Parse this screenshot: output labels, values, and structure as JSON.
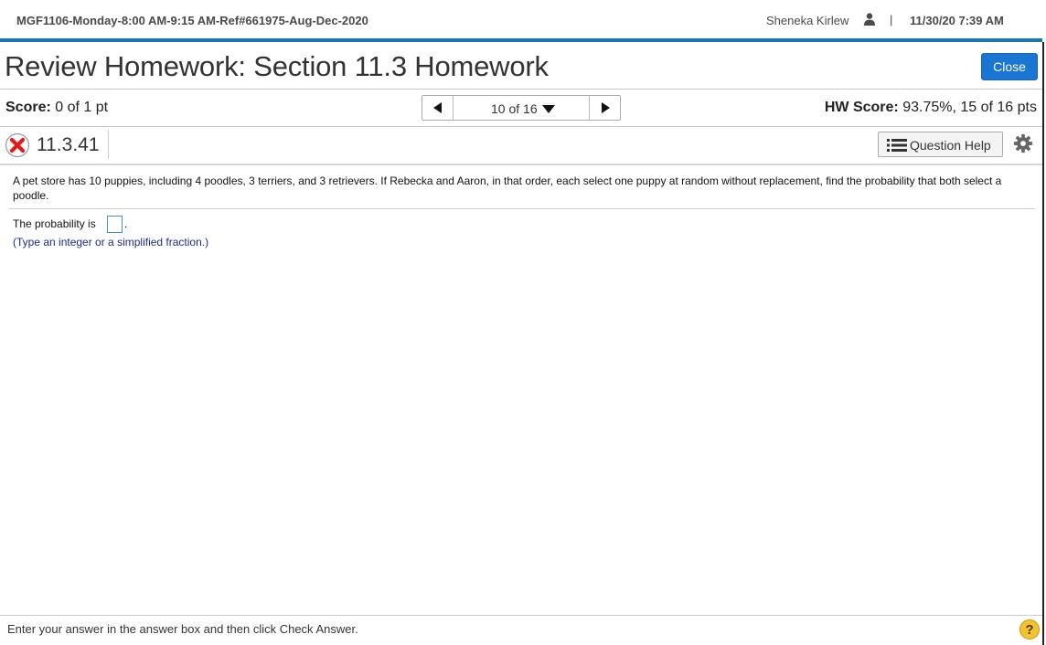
{
  "header": {
    "course": "MGF1106-Monday-8:00 AM-9:15 AM-Ref#661975-Aug-Dec-2020",
    "user_name": "Sheneka Kirlew",
    "separator": "|",
    "datetime": "11/30/20 7:39 AM",
    "user_icon": "user-icon"
  },
  "page": {
    "title": "Review Homework: Section 11.3 Homework",
    "close_label": "Close"
  },
  "score": {
    "label": "Score:",
    "value": "0 of 1 pt"
  },
  "pager": {
    "label": "10 of 16"
  },
  "hw_score": {
    "label": "HW Score:",
    "value": "93.75%, 15 of 16 pts"
  },
  "question": {
    "status_icon": "x-mark-icon",
    "number": "11.3.41",
    "help_label": "Question Help",
    "text": "A pet store has 10 puppies, including 4 poodles, 3 terriers, and 3 retrievers. If Rebecka and Aaron, in that order, each select one puppy at random without replacement, find the probability that both select a poodle.",
    "prompt": "The probability is",
    "answer_value": "",
    "period": ".",
    "hint": "(Type an integer or a simplified fraction.)"
  },
  "footer": {
    "instruction": "Enter your answer in the answer box and then click Check Answer.",
    "help_glyph": "?"
  },
  "colors": {
    "accent": "#1b7aa8",
    "close_button": "#1a76d2",
    "incorrect": "#e01b1b",
    "hint_text": "#1a2c8c",
    "help_badge": "#f2c230"
  }
}
